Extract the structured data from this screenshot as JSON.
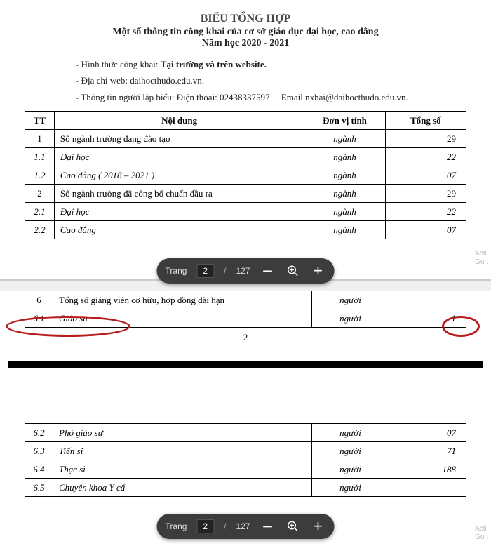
{
  "header": {
    "title1": "BIỂU TỔNG HỢP",
    "title2": "Một số thông tin công khai của cơ sở giáo dục đại học, cao đẳng",
    "year": "Năm học 2020 - 2021"
  },
  "info": {
    "line1_prefix": "- Hình thức công khai: ",
    "line1_bold": "Tại trường và trên website.",
    "line2": "- Địa chỉ web: daihocthudo.edu.vn.",
    "line3": "- Thông tin người lập biểu: Điện thoại: 02438337597     Email nxhai@daihocthudo.edu.vn."
  },
  "cols": {
    "tt": "TT",
    "nd": "Nội dung",
    "dv": "Đơn vị tính",
    "ts": "Tổng số"
  },
  "rows_top": [
    {
      "tt": "1",
      "nd": "Số ngành trường đang đào tạo",
      "dv": "ngành",
      "ts": "29",
      "italic": false
    },
    {
      "tt": "1.1",
      "nd": "Đại học",
      "dv": "ngành",
      "ts": "22",
      "italic": true
    },
    {
      "tt": "1.2",
      "nd": "Cao đẳng ( 2018 – 2021 )",
      "dv": "ngành",
      "ts": "07",
      "italic": true
    },
    {
      "tt": "2",
      "nd": "Số ngành trường đã công bố chuẩn đầu ra",
      "dv": "ngành",
      "ts": "29",
      "italic": false
    },
    {
      "tt": "2.1",
      "nd": "Đại học",
      "dv": "ngành",
      "ts": "22",
      "italic": true
    },
    {
      "tt": "2.2",
      "nd": "Cao đẳng",
      "dv": "ngành",
      "ts": "07",
      "italic": true
    }
  ],
  "rows_mid": [
    {
      "tt": "6",
      "nd": "Tổng số giảng viên cơ hữu, hợp đồng dài hạn",
      "dv": "người",
      "ts": "",
      "italic": false
    },
    {
      "tt": "6.1",
      "nd": "Giáo sư",
      "dv": "người",
      "ts": "1",
      "italic": true
    }
  ],
  "page_number_mid": "2",
  "rows_bot": [
    {
      "tt": "6.2",
      "nd": "Phó giáo sư",
      "dv": "người",
      "ts": "07",
      "italic": true
    },
    {
      "tt": "6.3",
      "nd": "Tiến sĩ",
      "dv": "người",
      "ts": "71",
      "italic": true
    },
    {
      "tt": "6.4",
      "nd": "Thạc sĩ",
      "dv": "người",
      "ts": "188",
      "italic": true
    },
    {
      "tt": "6.5",
      "nd": "Chuyên khoa Y cấ",
      "dv": "người",
      "ts": "",
      "italic": true
    }
  ],
  "toolbar": {
    "page_label": "Trang",
    "page_current": "2",
    "sep": "/",
    "page_total": "127",
    "minus": "−",
    "zoom_icon": "⊕",
    "plus": "+"
  },
  "watermark": {
    "l1": "Acti",
    "l2": "Go t"
  }
}
